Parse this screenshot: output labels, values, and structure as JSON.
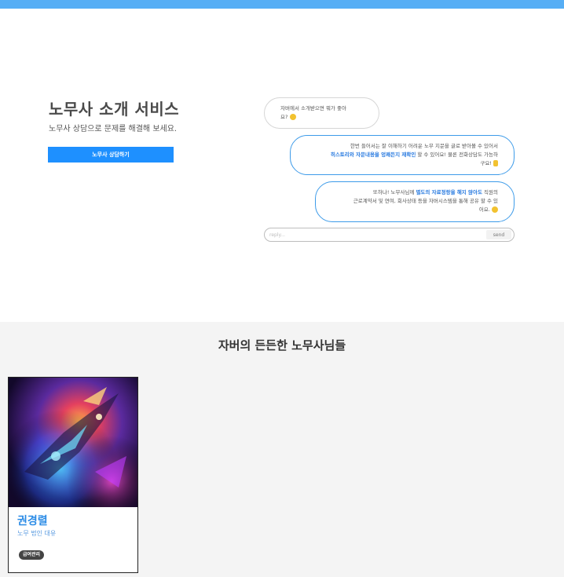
{
  "hero": {
    "title": "노무사 소개 서비스",
    "subtitle": "노무사 상담으로 문제를 해결해 보세요.",
    "cta_label": "노무사 상담하기"
  },
  "chat": {
    "bubble1": {
      "line1": "자버에서 소개받으면 뭐가 좋아",
      "line2": "요?"
    },
    "bubble2": {
      "line1": "한번 들어서는 잘 이해하기 어려운 노무 지문을 글로 받아볼 수 있어서",
      "hl": "히스토리와 자문내용을 엉쾌든지 재확인",
      "line2_rest": " 할 수 있어요! 물론 전화상담도 가능하",
      "line3": "구요!"
    },
    "bubble3": {
      "line1_pre": "또하나! 노무사님께 ",
      "hl": "별도의 자료정랑을 해지 않아도",
      "line1_post": " 직원의",
      "line2": "근로계약서 및 연여, 회사상태 등을 자버시스템을 통해 공유 할 수 있",
      "line3": "어요."
    },
    "reply_placeholder": "reply...",
    "send_label": "send"
  },
  "section": {
    "title": "자버의 든든한 노무사님들"
  },
  "lawyers": [
    {
      "name": "권경렬",
      "firm": "노무 법인 대유",
      "tag": "급여관리"
    }
  ],
  "colors": {
    "top_bar": "#56aef5",
    "accent": "#1e90ff",
    "section_bg": "#f4f4f4",
    "bubble_border": "#3d9be9"
  }
}
